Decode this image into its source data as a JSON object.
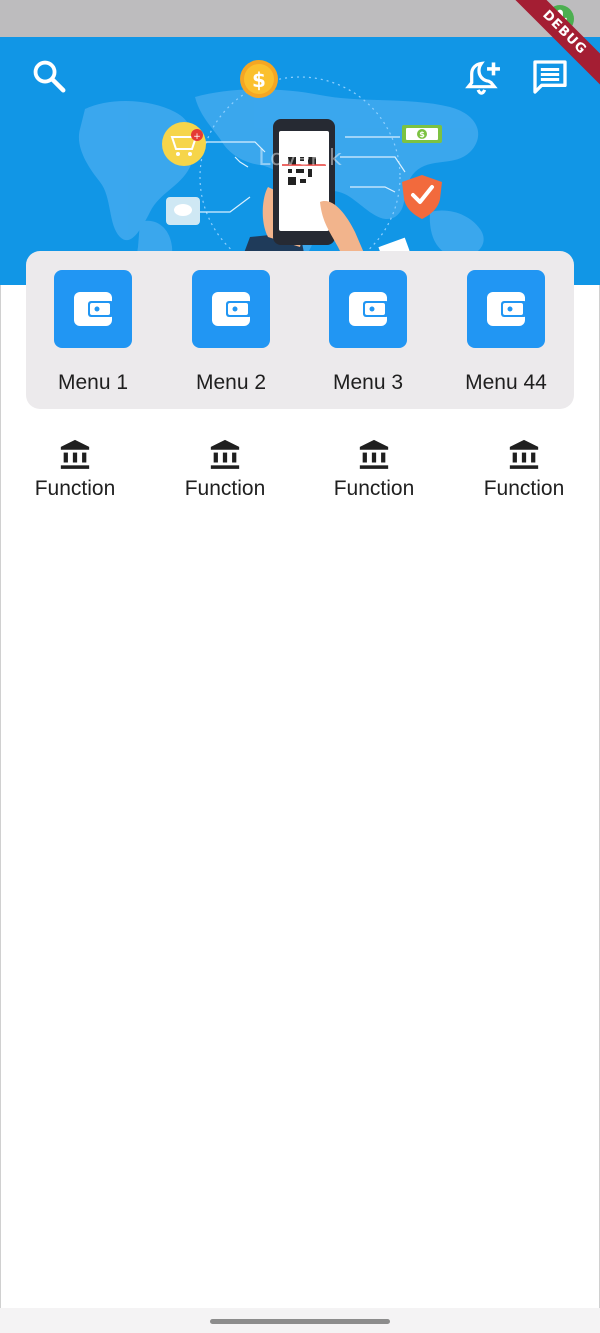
{
  "menu": {
    "items": [
      {
        "label": "Menu 1",
        "icon": "wallet-icon"
      },
      {
        "label": "Menu 2",
        "icon": "wallet-icon"
      },
      {
        "label": "Menu 3",
        "icon": "wallet-icon"
      },
      {
        "label": "Menu 44",
        "icon": "wallet-icon"
      }
    ]
  },
  "functions": {
    "items": [
      {
        "label": "Function",
        "icon": "bank-icon"
      },
      {
        "label": "Function",
        "icon": "bank-icon"
      },
      {
        "label": "Function",
        "icon": "bank-icon"
      },
      {
        "label": "Function",
        "icon": "bank-icon"
      }
    ]
  },
  "banner": {
    "watermark": "LovePik",
    "debug_label": "DEBUG"
  },
  "colors": {
    "header": "#1196e6",
    "accent": "#2196f3",
    "card": "#eceaec",
    "status_bar": "#bdbcbe",
    "debug_ribbon": "#a41e33"
  }
}
